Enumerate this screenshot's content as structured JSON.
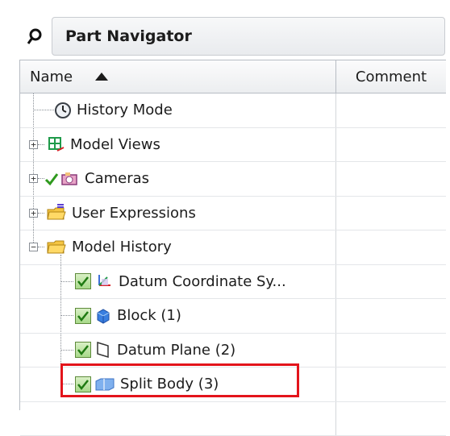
{
  "panel": {
    "title": "Part Navigator"
  },
  "columns": {
    "name": "Name",
    "comment": "Comment"
  },
  "rows": [
    {
      "label": "History Mode",
      "icon": "clock-icon"
    },
    {
      "label": "Model Views",
      "icon": "model-views-icon"
    },
    {
      "label": "Cameras",
      "icon": "camera-icon"
    },
    {
      "label": "User Expressions",
      "icon": "folder-expressions-icon"
    },
    {
      "label": "Model History",
      "icon": "folder-open-icon"
    },
    {
      "label": "Datum Coordinate Sy...",
      "icon": "datum-csys-icon"
    },
    {
      "label": "Block (1)",
      "icon": "block-icon"
    },
    {
      "label": "Datum Plane (2)",
      "icon": "datum-plane-icon"
    },
    {
      "label": "Split Body (3)",
      "icon": "split-body-icon"
    }
  ],
  "colors": {
    "highlight": "#e3141b",
    "check": "#2f9a1e"
  }
}
